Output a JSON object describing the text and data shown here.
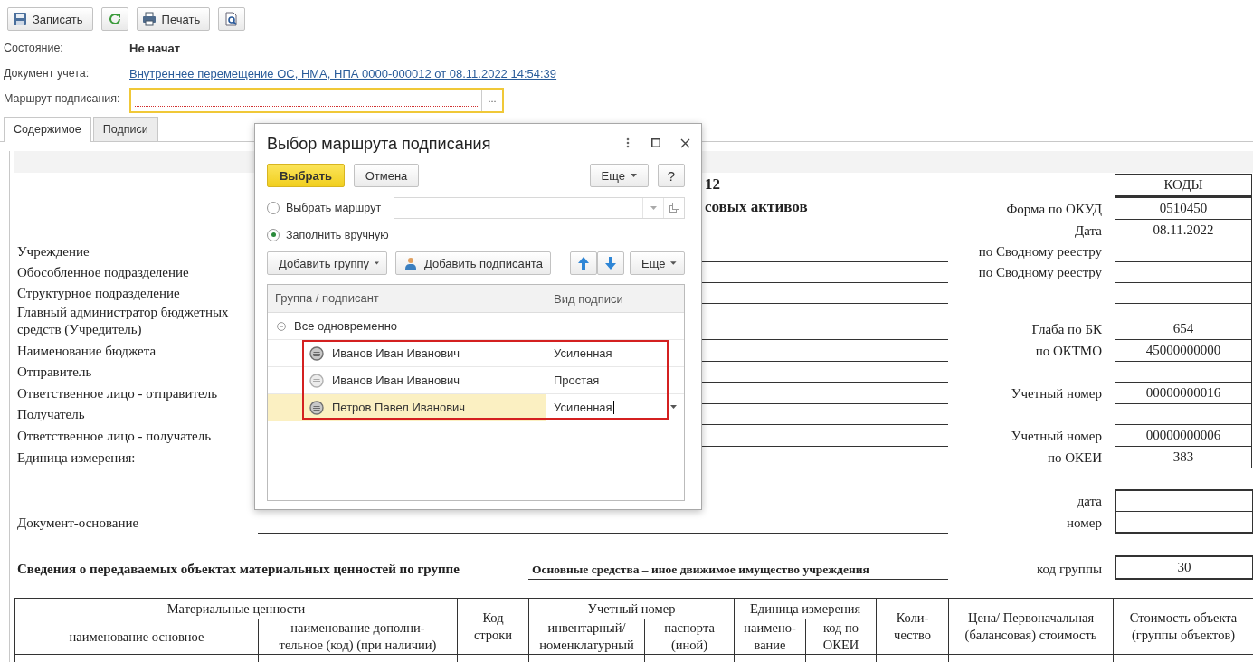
{
  "toolbar": [
    {
      "kind": "save",
      "label": "Записать"
    },
    {
      "kind": "refresh"
    },
    {
      "kind": "print",
      "label": "Печать"
    },
    {
      "kind": "preview"
    }
  ],
  "fields": {
    "state": {
      "label": "Состояние:",
      "value": "Не начат"
    },
    "document": {
      "label": "Документ учета:",
      "link": "Внутреннее перемещение ОС, НМА, НПА 0000-000012 от 08.11.2022 14:54:39"
    },
    "route": {
      "label": "Маршрут подписания:",
      "button": "...",
      "required": true
    }
  },
  "tabs": [
    {
      "label": "Содержимое",
      "selected": true
    },
    {
      "label": "Подписи",
      "selected": false
    }
  ],
  "document": {
    "rows": [
      {
        "title": "12",
        "code": "КОДЫ"
      },
      {
        "title": "совых активов",
        "code_label": "Форма по ОКУД",
        "code": "0510450"
      },
      {
        "code_label": "Дата",
        "code": "08.11.2022"
      },
      {
        "label": "Учреждение",
        "code_label": "по Сводному реестру"
      },
      {
        "label": "Обособленное подразделение",
        "code_label": "по Сводному реестру"
      },
      {
        "label": "Структурное подразделение"
      },
      {
        "label": "Главный администратор бюджетных средств (Учредитель)",
        "code_label": "Глаба по БК",
        "code": "654"
      },
      {
        "label": "Наименование бюджета",
        "code_label": "по ОКТМО",
        "code": "45000000000"
      },
      {
        "label": "Отправитель"
      },
      {
        "label": "Ответственное лицо - отправитель",
        "code_label": "Учетный номер",
        "code": "00000000016"
      },
      {
        "label": "Получатель"
      },
      {
        "label": "Ответственное лицо - получатель",
        "code_label": "Учетный номер",
        "code": "00000000006"
      },
      {
        "label": "Единица измерения:",
        "code_label": "по ОКЕИ",
        "code": "383",
        "no_line": true
      }
    ],
    "reference_rows": [
      {
        "code_label": "дата"
      },
      {
        "label": "Документ-основание",
        "code_label": "номер"
      }
    ],
    "group": {
      "label": "Сведения о передаваемых объектах материальных ценностей по группе",
      "value": "Основные средства –  иное движимое имущество учреждения",
      "code_label": "код группы",
      "code": "30"
    },
    "table": {
      "header_rows": [
        [
          {
            "text": "Материальные ценности",
            "colspan": 2
          },
          {
            "text": "Код\nстроки",
            "rowspan": 2
          },
          {
            "text": "Учетный номер",
            "colspan": 2
          },
          {
            "text": "Единица измерения",
            "colspan": 2
          },
          {
            "text": "Коли-\nчество",
            "rowspan": 2
          },
          {
            "text": "Цена/ Первоначальная\n(балансовая) стоимость",
            "rowspan": 2
          },
          {
            "text": "Стоимость объекта\n(группы объектов)",
            "rowspan": 2
          }
        ],
        [
          {
            "text": "наименование основное"
          },
          {
            "text": "наименование дополни-\nтельное (код) (при наличии)"
          },
          {
            "text": "инвентарный/\nноменклатурный"
          },
          {
            "text": "паспорта\n(иной)"
          },
          {
            "text": "наимено-\nвание"
          },
          {
            "text": "код по\nОКЕИ"
          }
        ]
      ]
    }
  },
  "dialog": {
    "title": "Выбор маршрута подписания",
    "choose": "Выбрать",
    "cancel": "Отмена",
    "more": "Еще",
    "help": "?",
    "options": [
      {
        "label": "Выбрать маршрут",
        "selected": false
      },
      {
        "label": "Заполнить вручную",
        "selected": true
      }
    ],
    "add_group": "Добавить группу",
    "add_signer": "Добавить подписанта",
    "more2": "Еще",
    "columns": [
      "Группа / подписант",
      "Вид подписи"
    ],
    "groups": [
      {
        "name": "Все одновременно",
        "expanded": true,
        "highlighted": true,
        "children": [
          {
            "name": "Иванов Иван Иванович",
            "sign": "Усиленная",
            "kind": "strong",
            "selected": false
          },
          {
            "name": "Иванов Иван Иванович",
            "sign": "Простая",
            "kind": "simple",
            "selected": false
          },
          {
            "name": "Петров Павел Иванович",
            "sign": "Усиленная",
            "kind": "strong",
            "selected": true
          }
        ]
      }
    ]
  }
}
